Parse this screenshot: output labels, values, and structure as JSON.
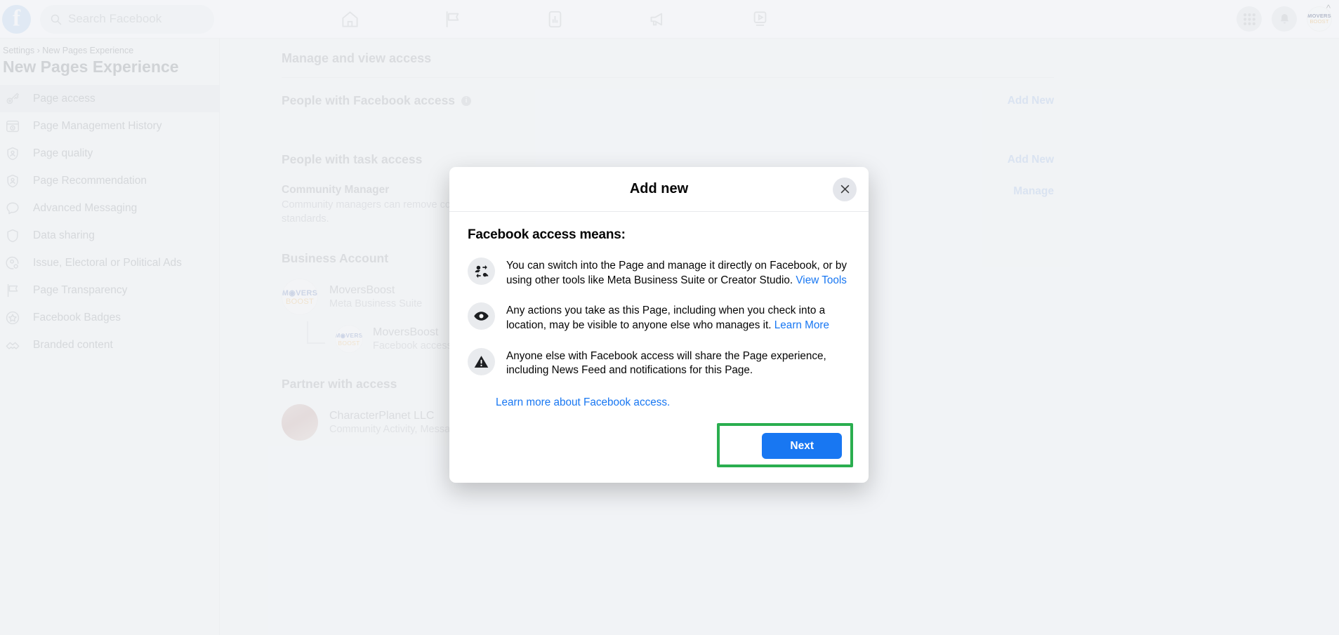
{
  "topbar": {
    "logo_letter": "f",
    "search_placeholder": "Search Facebook",
    "nav_icons": [
      "home-icon",
      "flag-icon",
      "insights-icon",
      "megaphone-icon",
      "video-icon"
    ],
    "grid_icon": "grid-menu-icon",
    "bell_icon": "notifications-bell-icon",
    "avatar_top": "MOVERS",
    "avatar_bottom": "BOOST"
  },
  "sidebar": {
    "breadcrumb": "Settings › New Pages Experience",
    "title": "New Pages Experience",
    "items": [
      {
        "label": "Page access",
        "icon": "key-icon",
        "active": true
      },
      {
        "label": "Page Management History",
        "icon": "history-window-icon",
        "active": false
      },
      {
        "label": "Page quality",
        "icon": "shield-person-icon",
        "active": false
      },
      {
        "label": "Page Recommendation",
        "icon": "shield-person-icon",
        "active": false
      },
      {
        "label": "Advanced Messaging",
        "icon": "chat-bubble-icon",
        "active": false
      },
      {
        "label": "Data sharing",
        "icon": "shield-icon",
        "active": false
      },
      {
        "label": "Issue, Electoral or Political Ads",
        "icon": "person-gear-icon",
        "active": false
      },
      {
        "label": "Page Transparency",
        "icon": "flag-icon",
        "active": false
      },
      {
        "label": "Facebook Badges",
        "icon": "star-circle-icon",
        "active": false
      },
      {
        "label": "Branded content",
        "icon": "handshake-icon",
        "active": false
      }
    ]
  },
  "main": {
    "heading": "Manage and view access",
    "facebook_access": {
      "title": "People with Facebook access",
      "info_glyph": "i",
      "action": "Add New"
    },
    "task_access": {
      "title": "People with task access",
      "action": "Add New"
    },
    "community_manager": {
      "title": "Community Manager",
      "desc": "Community managers can remove comments and ban people who violate community standards.",
      "action": "Manage"
    },
    "business_account": {
      "title": "Business Account",
      "primary_name": "MoversBoost",
      "primary_sub": "Meta Business Suite",
      "nested_name": "MoversBoost",
      "nested_sub": "Facebook access",
      "avatar_top": "M◉VERS",
      "avatar_bottom": "BOOST"
    },
    "partner": {
      "title": "Partner with access",
      "name": "CharacterPlanet LLC",
      "permissions": "Community Activity, Messages, Insights, Ads, Content, Permissions"
    }
  },
  "modal": {
    "title": "Add new",
    "close_icon": "close-icon",
    "body_heading": "Facebook access means:",
    "bullets": [
      {
        "icon": "switch-users-icon",
        "text": "You can switch into the Page and manage it directly on Facebook, or by using other tools like Meta Business Suite or Creator Studio. ",
        "link": "View Tools"
      },
      {
        "icon": "eye-icon",
        "text": "Any actions you take as this Page, including when you check into a location, may be visible to anyone else who manages it. ",
        "link": "Learn More"
      },
      {
        "icon": "warning-triangle-icon",
        "text": "Anyone else with Facebook access will share the Page experience, including News Feed and notifications for this Page.",
        "link": ""
      }
    ],
    "footer_link": "Learn more about Facebook access.",
    "next_label": "Next"
  },
  "colors": {
    "accent_blue": "#1877f2",
    "link_blue": "#1877f2",
    "highlight_green": "#2aae4f",
    "page_bg": "#f5f6f7"
  }
}
